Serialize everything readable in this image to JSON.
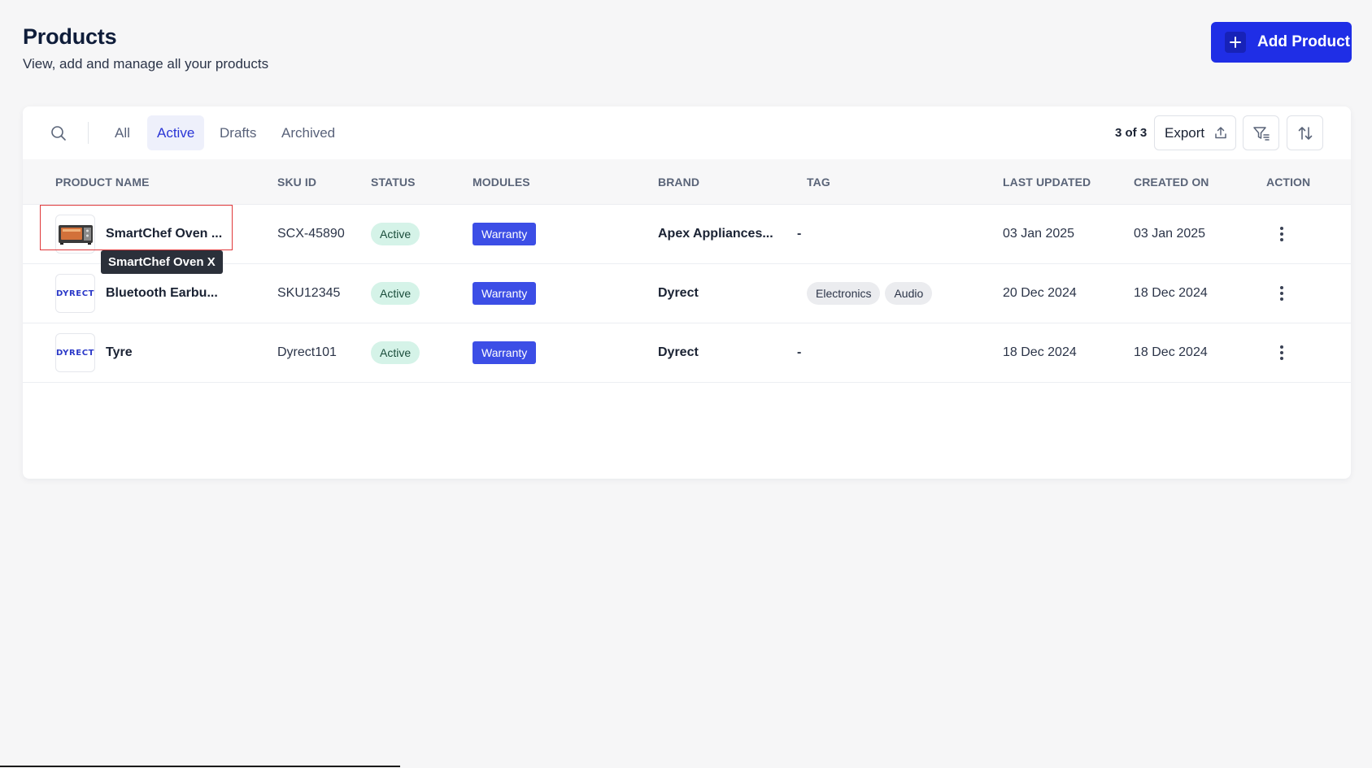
{
  "header": {
    "title": "Products",
    "subtitle": "View, add and manage all your products",
    "add_button_label": "Add Product"
  },
  "toolbar": {
    "tabs": [
      "All",
      "Active",
      "Drafts",
      "Archived"
    ],
    "active_tab": "Active",
    "count_label": "3 of 3",
    "export_label": "Export"
  },
  "table": {
    "columns": [
      "PRODUCT NAME",
      "SKU ID",
      "STATUS",
      "MODULES",
      "BRAND",
      "TAG",
      "LAST UPDATED",
      "CREATED ON",
      "ACTION"
    ],
    "rows": [
      {
        "name": "SmartChef Oven ...",
        "image": "oven-image",
        "sku": "SCX-45890",
        "status": "Active",
        "module": "Warranty",
        "brand": "Apex Appliances...",
        "tags": [],
        "tag_empty": "-",
        "last_updated": "03 Jan 2025",
        "created_on": "03 Jan 2025"
      },
      {
        "name": "Bluetooth Earbu...",
        "image": "DYRECT",
        "sku": "SKU12345",
        "status": "Active",
        "module": "Warranty",
        "brand": "Dyrect",
        "tags": [
          "Electronics",
          "Audio"
        ],
        "tag_empty": "",
        "last_updated": "20 Dec 2024",
        "created_on": "18 Dec 2024"
      },
      {
        "name": "Tyre",
        "image": "DYRECT",
        "sku": "Dyrect101",
        "status": "Active",
        "module": "Warranty",
        "brand": "Dyrect",
        "tags": [],
        "tag_empty": "-",
        "last_updated": "18 Dec 2024",
        "created_on": "18 Dec 2024"
      }
    ]
  },
  "tooltip": {
    "text": "SmartChef Oven X"
  },
  "colors": {
    "primary": "#1f2ee6",
    "module_badge": "#3c4ee6",
    "status_badge_bg": "#d5f3e8",
    "highlight": "#e0383a"
  }
}
